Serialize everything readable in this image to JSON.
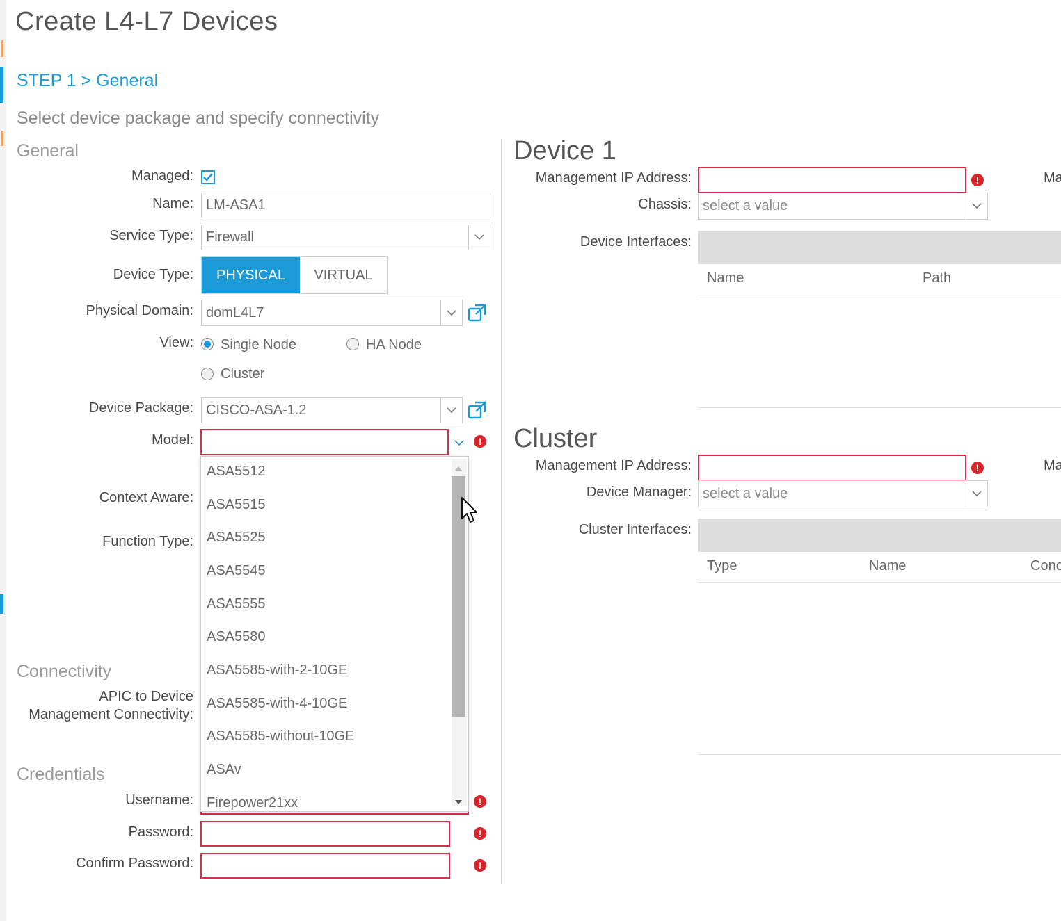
{
  "page": {
    "title": "Create L4-L7 Devices",
    "step": "STEP 1 > General",
    "subtitle": "Select device package and specify connectivity"
  },
  "general": {
    "section_title": "General",
    "managed_label": "Managed:",
    "managed_checked": true,
    "name_label": "Name:",
    "name_value": "LM-ASA1",
    "service_type_label": "Service Type:",
    "service_type_value": "Firewall",
    "device_type_label": "Device Type:",
    "device_type_options": [
      "PHYSICAL",
      "VIRTUAL"
    ],
    "device_type_selected": "PHYSICAL",
    "physical_domain_label": "Physical Domain:",
    "physical_domain_value": "domL4L7",
    "view_label": "View:",
    "view_options": [
      "Single Node",
      "HA Node",
      "Cluster"
    ],
    "view_selected": "Single Node",
    "device_package_label": "Device Package:",
    "device_package_value": "CISCO-ASA-1.2",
    "model_label": "Model:",
    "model_value": "",
    "context_aware_label": "Context Aware:",
    "function_type_label": "Function Type:"
  },
  "model_dropdown": {
    "options": [
      "ASA5512",
      "ASA5515",
      "ASA5525",
      "ASA5545",
      "ASA5555",
      "ASA5580",
      "ASA5585-with-2-10GE",
      "ASA5585-with-4-10GE",
      "ASA5585-without-10GE",
      "ASAv",
      "Firepower21xx"
    ]
  },
  "connectivity": {
    "section_title": "Connectivity",
    "apic_label_line1": "APIC to Device",
    "apic_label_line2": "Management Connectivity:"
  },
  "credentials": {
    "section_title": "Credentials",
    "username_label": "Username:",
    "password_label": "Password:",
    "confirm_password_label": "Confirm Password:"
  },
  "device1": {
    "title": "Device 1",
    "mgmt_ip_label": "Management IP Address:",
    "mgmt_ip_value": "",
    "chassis_label": "Chassis:",
    "chassis_placeholder": "select a value",
    "interfaces_label": "Device Interfaces:",
    "columns": [
      "Name",
      "Path"
    ],
    "cut_label": "Ma"
  },
  "cluster": {
    "title": "Cluster",
    "mgmt_ip_label": "Management IP Address:",
    "mgmt_ip_value": "",
    "device_manager_label": "Device Manager:",
    "device_manager_placeholder": "select a value",
    "interfaces_label": "Cluster Interfaces:",
    "columns": [
      "Type",
      "Name",
      "Conc"
    ],
    "cut_label": "Ma"
  },
  "colors": {
    "accent": "#1a9bd7",
    "error": "#d9242a",
    "error_border": "#d9304a"
  }
}
